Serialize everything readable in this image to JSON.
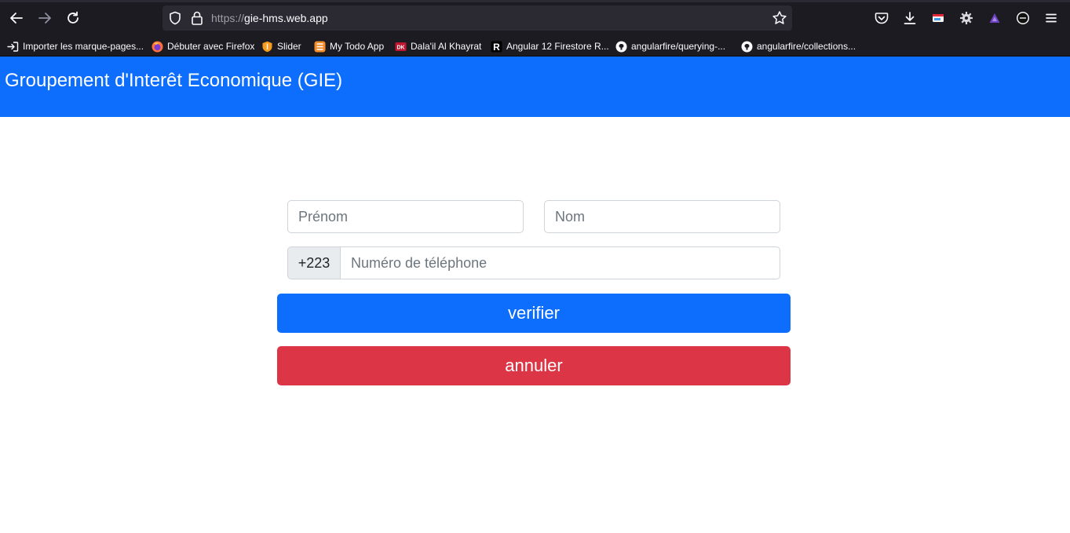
{
  "browser": {
    "url_scheme": "https://",
    "url_host": "gie-hms.web.app",
    "icons": {
      "back": "arrow-left-icon",
      "forward": "arrow-right-icon",
      "reload": "reload-icon",
      "tracking": "shield-icon",
      "lock": "lock-icon",
      "bookmark_star": "star-icon",
      "pocket": "pocket-icon",
      "downloads": "download-icon",
      "menu": "hamburger-icon"
    },
    "bookmarks": [
      {
        "label": "Importer les marque-pages...",
        "icon": "import-icon"
      },
      {
        "label": "Débuter avec Firefox",
        "icon": "firefox-icon"
      },
      {
        "label": "Slider",
        "icon": "shield-orange-icon"
      },
      {
        "label": "My Todo App",
        "icon": "todo-icon"
      },
      {
        "label": "Dala'il Al Khayrat",
        "icon": "dk-icon"
      },
      {
        "label": "Angular 12 Firestore R...",
        "icon": "r-icon"
      },
      {
        "label": "angularfire/querying-...",
        "icon": "github-icon"
      },
      {
        "label": "angularfire/collections...",
        "icon": "github-icon"
      }
    ]
  },
  "app": {
    "title": "Groupement d'Interêt Economique (GIE)",
    "colors": {
      "primary": "#0d6efd",
      "danger": "#dc3545"
    }
  },
  "form": {
    "prenom_placeholder": "Prénom",
    "nom_placeholder": "Nom",
    "phone_prefix": "+223",
    "phone_placeholder": "Numéro de téléphone",
    "verify_label": "verifier",
    "cancel_label": "annuler"
  }
}
